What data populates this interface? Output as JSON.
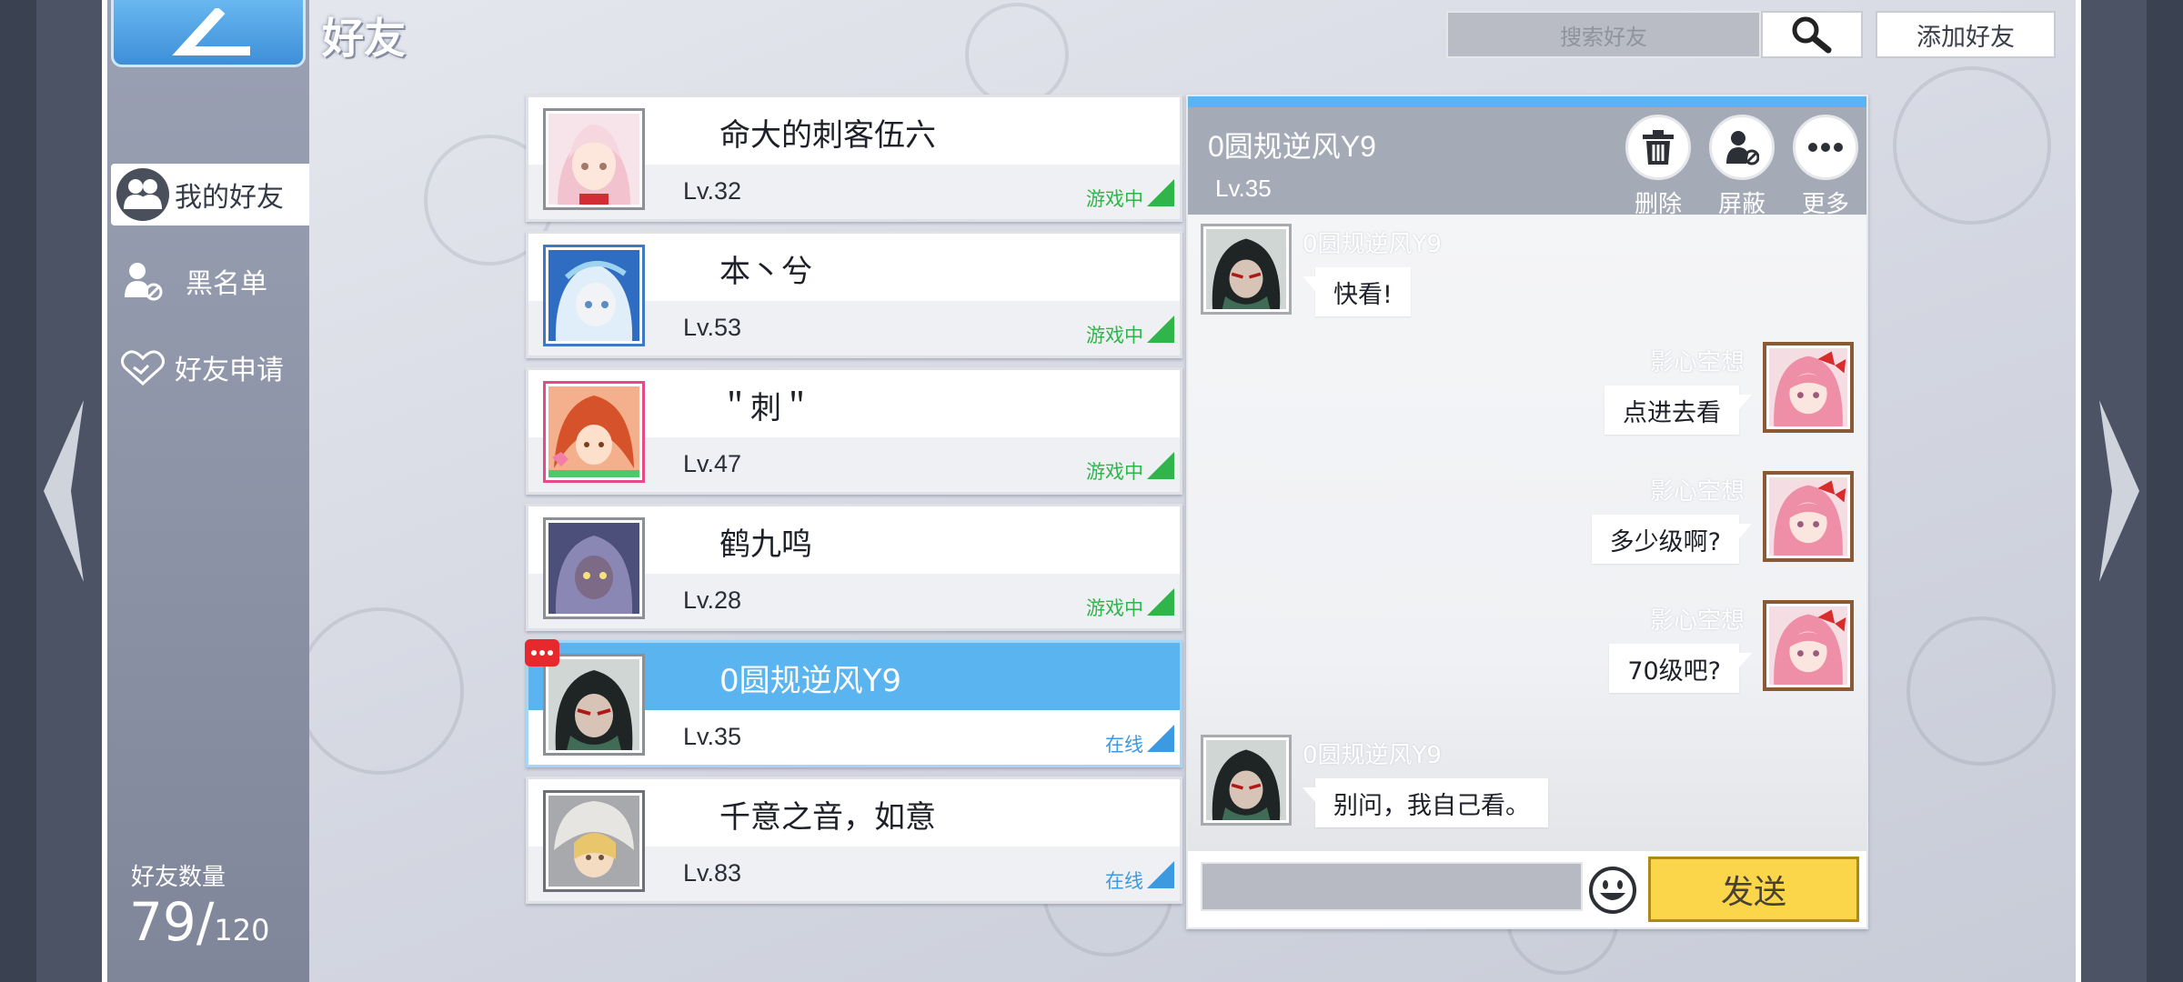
{
  "page": {
    "title": "好友"
  },
  "nav": {
    "items": [
      {
        "label": "我的好友",
        "active": true,
        "icon": "friends-icon"
      },
      {
        "label": "黑名单",
        "active": false,
        "icon": "blocked-user-icon"
      },
      {
        "label": "好友申请",
        "active": false,
        "icon": "handshake-icon"
      }
    ],
    "friend_count_label": "好友数量",
    "friend_count_current": "79",
    "friend_count_separator": "/",
    "friend_count_max": "120"
  },
  "search": {
    "placeholder": "搜索好友",
    "add_friend_label": "添加好友"
  },
  "friends": [
    {
      "name": "命大的刺客伍六",
      "level": "Lv.32",
      "status": "游戏中",
      "status_type": "playing"
    },
    {
      "name": "本丶兮",
      "level": "Lv.53",
      "status": "游戏中",
      "status_type": "playing"
    },
    {
      "name": "＂刺＂",
      "level": "Lv.47",
      "status": "游戏中",
      "status_type": "playing"
    },
    {
      "name": "鹤九鸣",
      "level": "Lv.28",
      "status": "游戏中",
      "status_type": "playing"
    },
    {
      "name": "0圆规逆风Y9",
      "level": "Lv.35",
      "status": "在线",
      "status_type": "online",
      "selected": true,
      "has_message": true
    },
    {
      "name": "千意之音，如意",
      "level": "Lv.83",
      "status": "在线",
      "status_type": "online"
    }
  ],
  "chat": {
    "name": "0圆规逆风Y9",
    "level": "Lv.35",
    "actions": {
      "delete": "删除",
      "block": "屏蔽",
      "more": "更多"
    },
    "messages": [
      {
        "side": "left",
        "sender": "0圆规逆风Y9",
        "text": "快看!"
      },
      {
        "side": "right",
        "sender": "影心空想",
        "text": "点进去看"
      },
      {
        "side": "right",
        "sender": "影心空想",
        "text": "多少级啊?"
      },
      {
        "side": "right",
        "sender": "影心空想",
        "text": "70级吧?"
      },
      {
        "side": "left",
        "sender": "0圆规逆风Y9",
        "text": "别问，我自己看。"
      }
    ],
    "input_value": "",
    "send_label": "发送"
  },
  "colors": {
    "accent": "#5ab4f0",
    "playing": "#2fb54a",
    "online": "#3d9ae0",
    "send": "#fbd64a",
    "badge": "#e7282d"
  }
}
